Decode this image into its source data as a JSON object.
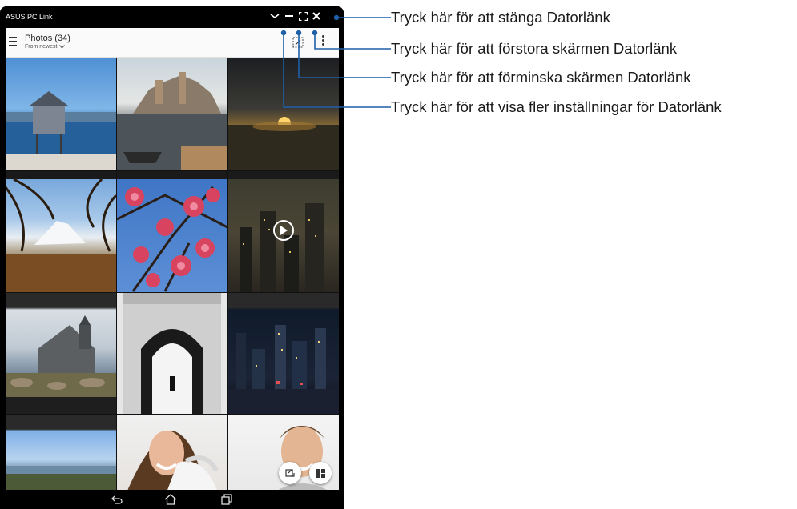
{
  "window": {
    "title": "ASUS PC Link"
  },
  "appbar": {
    "title": "Photos (34)",
    "sort_label": "From newest"
  },
  "colors": {
    "accent_line": "#1f5fa8",
    "frame": "#000000",
    "appbar_bg": "#fafafa"
  },
  "icons": [
    "chevron-down-icon",
    "minimize-icon",
    "fullscreen-icon",
    "close-icon",
    "hamburger-menu-icon",
    "select-icon",
    "more-vert-icon",
    "play-icon",
    "edit-icon",
    "layout-icon",
    "back-icon",
    "home-icon",
    "recent-apps-icon"
  ],
  "callouts": [
    {
      "text": "Tryck här för att stänga Datorlänk"
    },
    {
      "text": "Tryck här för att förstora skärmen Datorlänk"
    },
    {
      "text": "Tryck här för att förminska skärmen Datorlänk"
    },
    {
      "text": "Tryck här för att visa fler inställningar för Datorlänk"
    }
  ],
  "photos": [
    {
      "subject": "stilt house by lake"
    },
    {
      "subject": "castle by water with boat"
    },
    {
      "subject": "sunset over field"
    },
    {
      "subject": "snowy mountain through branches"
    },
    {
      "subject": "pink blossoms"
    },
    {
      "subject": "city at night video"
    },
    {
      "subject": "stone church by lake"
    },
    {
      "subject": "stone archway black and white"
    },
    {
      "subject": "city skyline at night"
    },
    {
      "subject": "coastal landscape"
    },
    {
      "subject": "smiling woman in winter coat"
    },
    {
      "subject": "smiling man"
    }
  ]
}
